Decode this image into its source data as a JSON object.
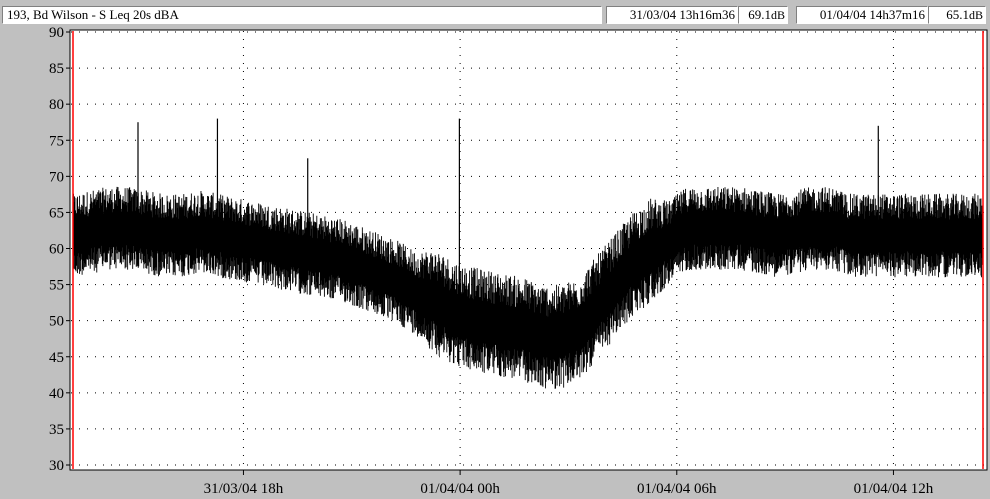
{
  "header": {
    "title": "193, Bd Wilson - S  Leq 20s  dBA",
    "cursor_start": {
      "time": "31/03/04 13h16m36",
      "value": "69.1",
      "unit": "dB"
    },
    "cursor_end": {
      "time": "01/04/04 14h37m16",
      "value": "65.1",
      "unit": "dB"
    }
  },
  "colors": {
    "background": "#c0c0c0",
    "plot_background": "#ffffff",
    "trace": "#000000",
    "start_cursor": "#ff0000",
    "end_cursor": "#ff0000"
  },
  "chart_data": {
    "type": "line",
    "title": "193, Bd Wilson - S  Leq 20s  dBA",
    "xlabel": "",
    "ylabel": "",
    "ylim": [
      30,
      90
    ],
    "yticks": [
      30,
      35,
      40,
      45,
      50,
      55,
      60,
      65,
      70,
      75,
      80,
      85,
      90
    ],
    "ytick_labels": [
      "30",
      "35",
      "40",
      "45",
      "50",
      "55",
      "60",
      "65",
      "70",
      "75",
      "80",
      "85",
      "90"
    ],
    "xlim": [
      "31/03/04 13h16m36",
      "01/04/04 14h37m16"
    ],
    "xticks": [
      "31/03/04 18h",
      "01/04/04 00h",
      "01/04/04 06h",
      "01/04/04 12h"
    ],
    "grid": true,
    "series": [
      {
        "hours_from_start": [
          0.0,
          0.5,
          1.0,
          1.5,
          2.0,
          2.5,
          3.0,
          3.5,
          4.0,
          4.5,
          5.0,
          5.5,
          6.0,
          6.5,
          7.0,
          7.5,
          8.0,
          8.5,
          9.0,
          9.5,
          10.0,
          10.5,
          11.0,
          11.5,
          12.0,
          12.5,
          13.0,
          13.5,
          14.0,
          14.5,
          15.0,
          15.5,
          16.0,
          16.5,
          17.0,
          17.5,
          18.0,
          18.5,
          19.0,
          19.5,
          20.0,
          20.5,
          21.0,
          21.5,
          22.0,
          22.5,
          23.0,
          23.5,
          24.0,
          24.5,
          25.0,
          25.2
        ],
        "mean_dba": [
          62,
          62.5,
          63,
          63,
          62.5,
          62,
          62,
          62.5,
          62,
          61.5,
          61,
          60.5,
          60,
          59.5,
          59,
          58.5,
          57.5,
          56.5,
          55.5,
          54,
          53,
          51.5,
          50.5,
          50,
          49.5,
          49,
          48,
          48,
          49,
          52,
          55,
          58,
          60,
          61,
          63,
          63,
          63,
          63,
          62.5,
          62,
          62.5,
          63,
          63,
          62,
          62,
          62,
          62,
          62,
          62,
          62,
          62,
          62
        ],
        "spread_dba": [
          4,
          4,
          4,
          4,
          4,
          4,
          4,
          4,
          4,
          4,
          4,
          4,
          4,
          4,
          4,
          4,
          4,
          4,
          4,
          4,
          5,
          5,
          5,
          5,
          5,
          5,
          5,
          5,
          5,
          5,
          5,
          5,
          5,
          4,
          4,
          4,
          4,
          4,
          4,
          4,
          4,
          4,
          4,
          4,
          4,
          4,
          4,
          4,
          4,
          4,
          4,
          4
        ],
        "peaks": [
          {
            "hours_from_start": 1.8,
            "dba": 77.5
          },
          {
            "hours_from_start": 4.0,
            "dba": 78.0
          },
          {
            "hours_from_start": 6.5,
            "dba": 72.5
          },
          {
            "hours_from_start": 10.7,
            "dba": 78.0
          },
          {
            "hours_from_start": 22.3,
            "dba": 77.0
          }
        ]
      }
    ]
  }
}
